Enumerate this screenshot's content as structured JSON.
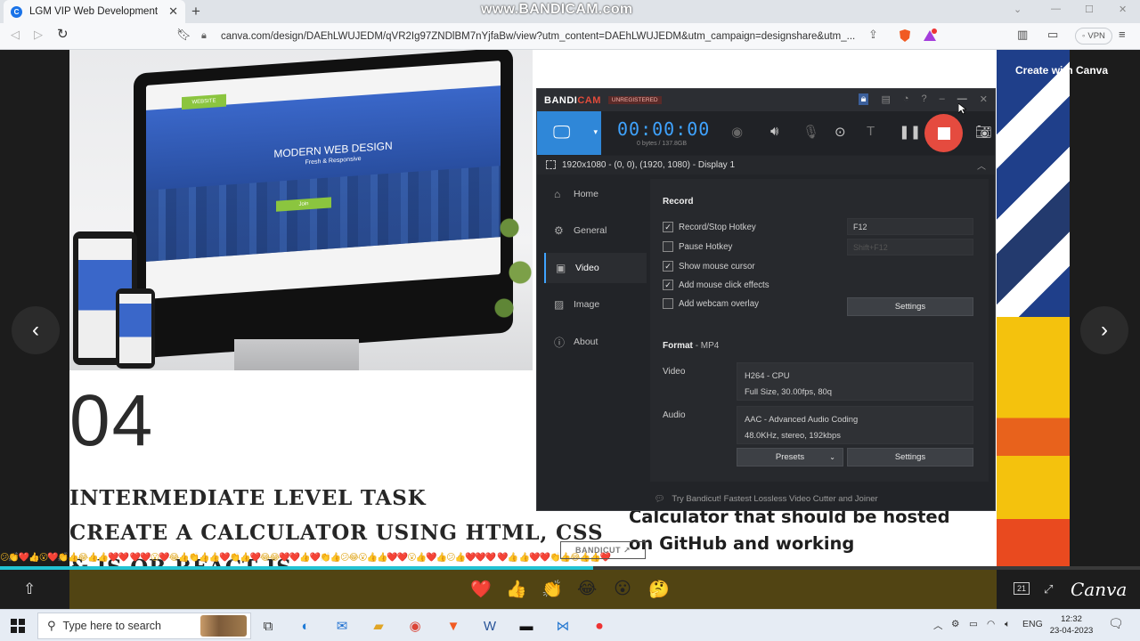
{
  "browser": {
    "tab_title": "LGM VIP Web Development",
    "new_tab": "+",
    "url": "canva.com/design/DAEhLWUJEDM/qVR2Ig97ZNDlBM7nYjfaBw/view?utm_content=DAEhLWUJEDM&utm_campaign=designshare&utm_...",
    "vpn_label": "VPN",
    "watermark": "www.BANDICAM.com"
  },
  "canva": {
    "create_button": "Create with Canva",
    "slide_number": "04",
    "task_lines": [
      "INTERMEDIATE LEVEL TASK",
      "CREATE A CALCULATOR USING HTML, CSS",
      "& JS OR REACT JS"
    ],
    "description_lines": [
      "Calculator that should be hosted",
      "on GitHub and working"
    ],
    "monitor_headline": "MODERN WEB DESIGN",
    "monitor_subline": "Fresh & Responsive",
    "monitor_tag": "WEBSITE",
    "monitor_button": "Join",
    "logo": "Canva",
    "page_counter": "21",
    "emoji_stream": "😕👏❤️👍😮❤️👏👍😂👍👍❤️❤️ ❤️❤️😮❤️😂👍👏👍👍❤️👏👍❤️😂😂❤️❤️👍❤️👏👍😕😂😮👍👍❤️❤️😮👍❤️👍😕👍❤️❤️❤️ ❤️👍 👍❤️❤️👏👍😂👍👍❤️",
    "reactions": [
      "❤️",
      "👍",
      "👏",
      "😂",
      "😮",
      "🤔"
    ],
    "progress_fraction": 0.52
  },
  "bandicam": {
    "logo_a": "BANDI",
    "logo_b": "CAM",
    "unregistered": "UNREGISTERED",
    "timer": "00:00:00",
    "bytes": "0 bytes / 137.8GB",
    "target": "1920x1080 - (0, 0), (1920, 1080) - Display 1",
    "sidebar": [
      "Home",
      "General",
      "Video",
      "Image",
      "About"
    ],
    "record_heading": "Record",
    "options": [
      {
        "label": "Record/Stop Hotkey",
        "checked": true
      },
      {
        "label": "Pause Hotkey",
        "checked": false
      },
      {
        "label": "Show mouse cursor",
        "checked": true
      },
      {
        "label": "Add mouse click effects",
        "checked": true
      },
      {
        "label": "Add webcam overlay",
        "checked": false
      }
    ],
    "hotkey_record": "F12",
    "hotkey_pause": "Shift+F12",
    "settings_label": "Settings",
    "format_heading": "Format",
    "format_value": "- MP4",
    "video_label": "Video",
    "video_line1": "H264 - CPU",
    "video_line2": "Full Size, 30.00fps, 80q",
    "audio_label": "Audio",
    "audio_line1": "AAC - Advanced Audio Coding",
    "audio_line2": "48.0KHz, stereo, 192kbps",
    "presets_label": "Presets",
    "bandicut": "BANDICUT",
    "footer": "Try Bandicut! Fastest Lossless Video Cutter and Joiner"
  },
  "taskbar": {
    "search_placeholder": "Type here to search",
    "lang": "ENG",
    "time": "12:32",
    "date": "23-04-2023"
  }
}
